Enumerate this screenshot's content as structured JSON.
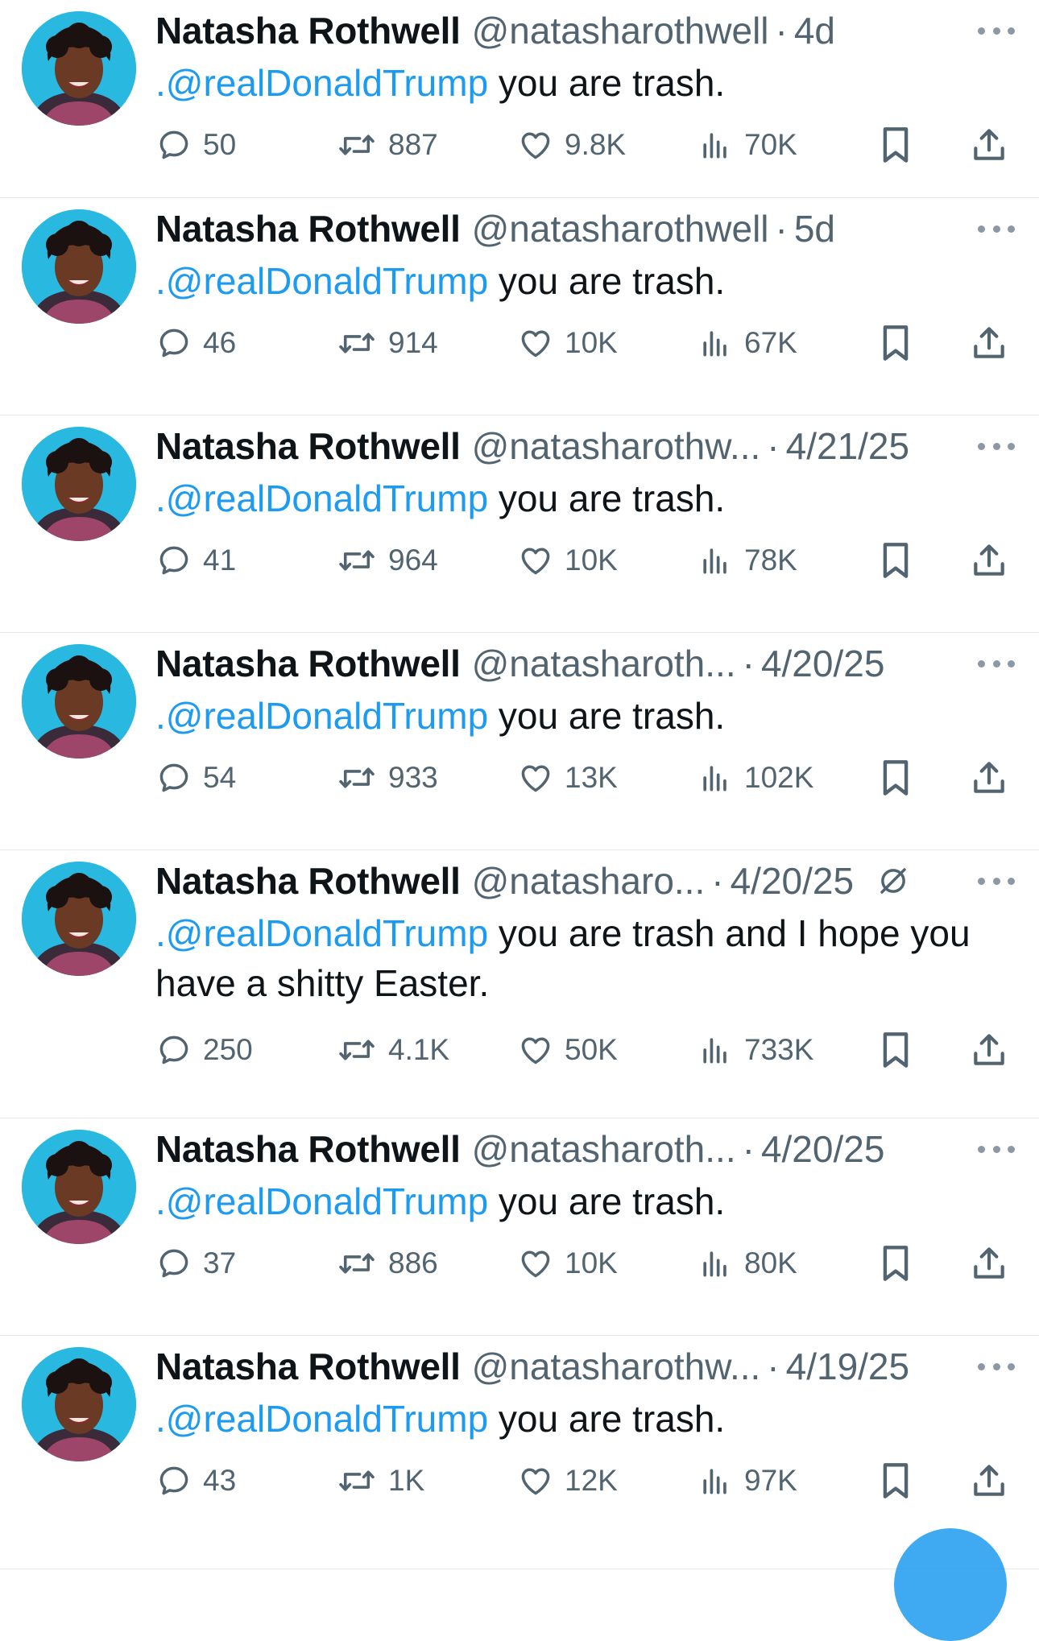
{
  "colors": {
    "accent": "#1d9bf0",
    "muted": "#536471",
    "avatar_bg": "#29b8df"
  },
  "icons": {
    "reply": "reply-icon",
    "retweet": "retweet-icon",
    "like": "heart-icon",
    "views": "views-icon",
    "bookmark": "bookmark-icon",
    "share": "share-icon",
    "more": "more-icon",
    "muted_conversation": "muted-icon"
  },
  "tweets": [
    {
      "name": "Natasha Rothwell",
      "handle": "@natasharothwell",
      "time": "4d",
      "mention": ".@realDonaldTrump",
      "text": " you are trash.",
      "replies": "50",
      "retweets": "887",
      "likes": "9.8K",
      "views": "70K"
    },
    {
      "name": "Natasha Rothwell",
      "handle": "@natasharothwell",
      "time": "5d",
      "mention": ".@realDonaldTrump",
      "text": " you are trash.",
      "replies": "46",
      "retweets": "914",
      "likes": "10K",
      "views": "67K"
    },
    {
      "name": "Natasha Rothwell",
      "handle": "@natasharothw...",
      "time": "4/21/25",
      "mention": ".@realDonaldTrump",
      "text": " you are trash.",
      "replies": "41",
      "retweets": "964",
      "likes": "10K",
      "views": "78K"
    },
    {
      "name": "Natasha Rothwell",
      "handle": "@natasharoth...",
      "time": "4/20/25",
      "mention": ".@realDonaldTrump",
      "text": " you are trash.",
      "replies": "54",
      "retweets": "933",
      "likes": "13K",
      "views": "102K"
    },
    {
      "name": "Natasha Rothwell",
      "handle": "@natasharo...",
      "time": "4/20/25",
      "mention": ".@realDonaldTrump",
      "text": " you are trash and I hope you have a shitty Easter.",
      "replies": "250",
      "retweets": "4.1K",
      "likes": "50K",
      "views": "733K"
    },
    {
      "name": "Natasha Rothwell",
      "handle": "@natasharoth...",
      "time": "4/20/25",
      "mention": ".@realDonaldTrump",
      "text": " you are trash.",
      "replies": "37",
      "retweets": "886",
      "likes": "10K",
      "views": "80K"
    },
    {
      "name": "Natasha Rothwell",
      "handle": "@natasharothw...",
      "time": "4/19/25",
      "mention": ".@realDonaldTrump",
      "text": " you are trash.",
      "replies": "43",
      "retweets": "1K",
      "likes": "12K",
      "views": "97K"
    }
  ]
}
